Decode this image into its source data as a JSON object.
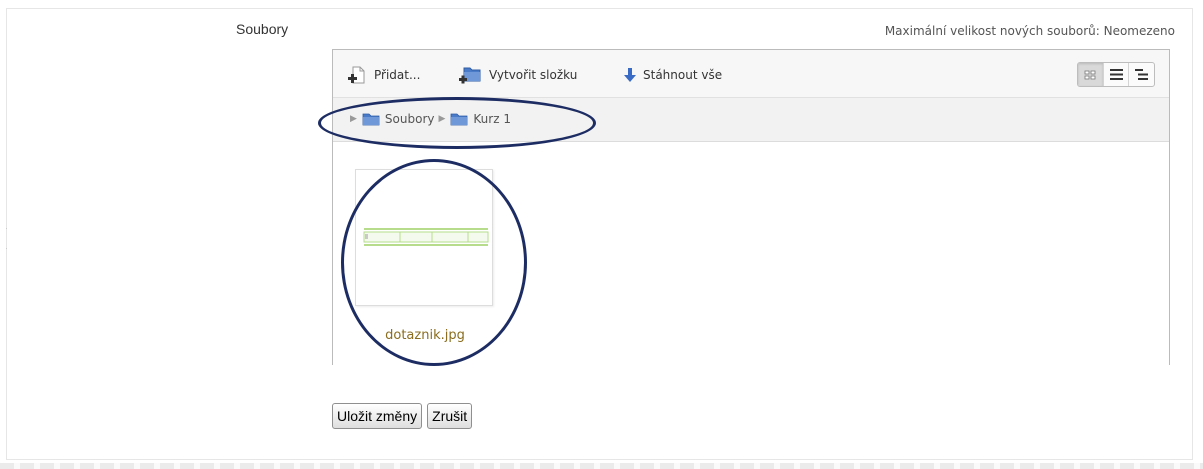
{
  "field": {
    "label": "Soubory",
    "max_size": "Maximální velikost nových souborů: Neomezeno"
  },
  "toolbar": {
    "add_label": "Přidat...",
    "create_folder_label": "Vytvořit složku",
    "download_all_label": "Stáhnout vše",
    "view_modes": [
      "icons",
      "list",
      "tree"
    ],
    "active_view": "icons"
  },
  "breadcrumb": [
    {
      "label": "Soubory",
      "icon": "folder-icon"
    },
    {
      "label": "Kurz 1",
      "icon": "folder-icon"
    }
  ],
  "files": [
    {
      "name": "dotaznik.jpg",
      "icon": "image-thumbnail"
    }
  ],
  "actions": {
    "save_label": "Uložit změny",
    "cancel_label": "Zrušit"
  },
  "colors": {
    "annotation": "#1d2d63",
    "folder": "#4a7bc8",
    "file_name": "#8a6d1e"
  }
}
